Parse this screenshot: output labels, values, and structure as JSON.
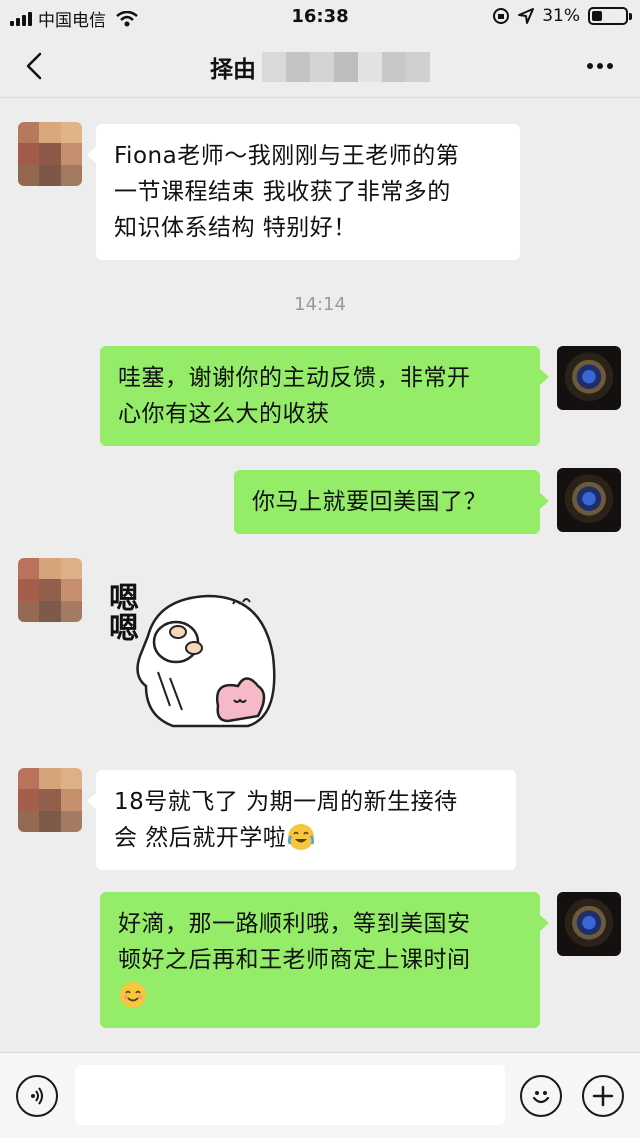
{
  "status_bar": {
    "carrier": "中国电信",
    "time": "16:38",
    "battery_percent": "31%",
    "battery_level": 0.31
  },
  "header": {
    "title": "择由",
    "back_icon": "chevron-left-icon",
    "more_icon": "more-dots-icon"
  },
  "messages": [
    {
      "side": "left",
      "type": "text",
      "lines": [
        "Fiona老师～我刚刚与王老师的第",
        "一节课程结束 我收获了非常多的",
        "知识体系结构 特别好！"
      ]
    },
    {
      "type": "time",
      "text": "14:14"
    },
    {
      "side": "right",
      "type": "text",
      "lines": [
        "哇塞，谢谢你的主动反馈，非常开",
        "心你有这么大的收获"
      ]
    },
    {
      "side": "right",
      "type": "text",
      "lines": [
        "你马上就要回美国了？"
      ]
    },
    {
      "side": "left",
      "type": "sticker",
      "sticker_text": "嗯嗯"
    },
    {
      "side": "left",
      "type": "text",
      "lines": [
        "18号就飞了 为期一周的新生接待",
        "会 然后就开学啦"
      ],
      "trailing_emoji": "crying-laughing-emoji"
    },
    {
      "side": "right",
      "type": "text",
      "lines": [
        "好滴，那一路顺利哦，等到美国安",
        "顿好之后再和王老师商定上课时间"
      ],
      "trailing_emoji": "smiling-face-emoji"
    }
  ],
  "input_bar": {
    "voice_icon": "voice-icon",
    "emoji_icon": "emoji-icon",
    "plus_icon": "plus-icon",
    "input_value": ""
  }
}
